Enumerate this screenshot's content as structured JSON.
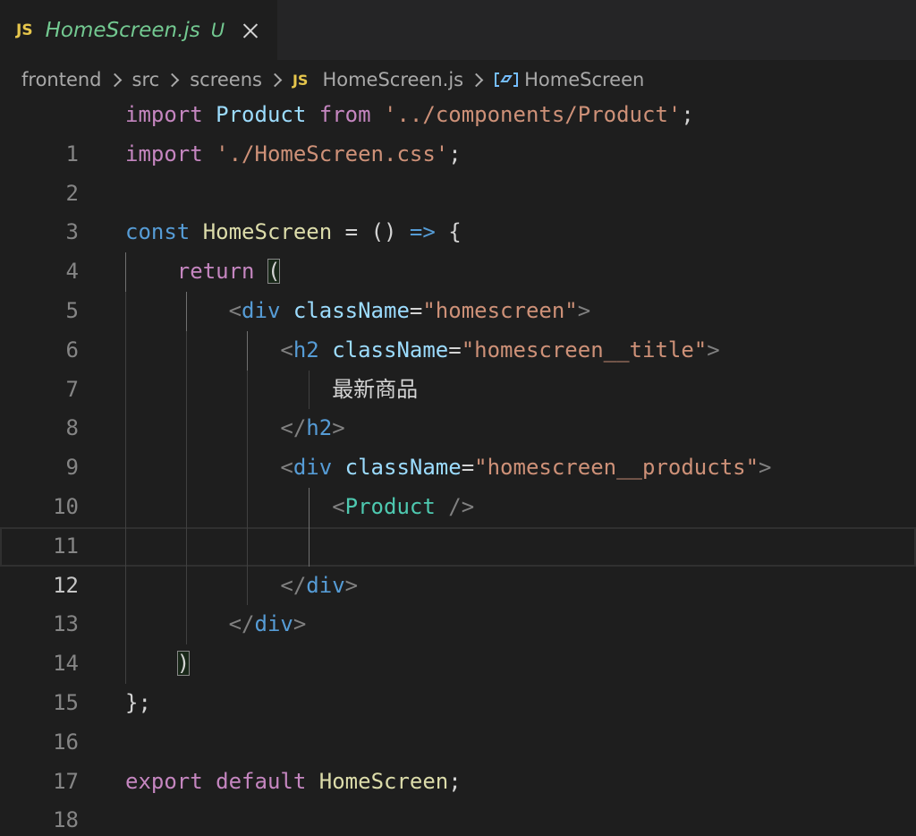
{
  "tab": {
    "badge": "JS",
    "filename": "HomeScreen.js",
    "status": "U"
  },
  "breadcrumbs": {
    "items": [
      "frontend",
      "src",
      "screens"
    ],
    "file_badge": "JS",
    "file": "HomeScreen.js",
    "symbol": "HomeScreen"
  },
  "colors": {
    "background": "#1e1e1e",
    "tab_text": "#73c991",
    "js_badge": "#e6c64c",
    "keyword_control": "#c586c0",
    "keyword": "#569cd6",
    "string": "#ce9178",
    "function": "#dcdcaa",
    "component": "#4ec9b0"
  },
  "editor": {
    "current_line": 12,
    "line_numbers": [
      "1",
      "2",
      "3",
      "4",
      "5",
      "6",
      "7",
      "8",
      "9",
      "10",
      "11",
      "12",
      "13",
      "14",
      "15",
      "16",
      "17",
      "18"
    ],
    "code": {
      "l1": {
        "import": "import",
        "name": "Product",
        "from": "from",
        "path": "'../components/Product'",
        "semi": ";"
      },
      "l2": {
        "import": "import",
        "path": "'./HomeScreen.css'",
        "semi": ";"
      },
      "l4": {
        "const": "const",
        "name": "HomeScreen",
        "eq": " = ",
        "parens": "()",
        "arrow": "=>",
        "brace": "{"
      },
      "l5": {
        "return": "return",
        "paren": "("
      },
      "l6": {
        "open": "<",
        "tag": "div",
        "attr": "className",
        "eq": "=",
        "value": "\"homescreen\"",
        "close": ">"
      },
      "l7": {
        "open": "<",
        "tag": "h2",
        "attr": "className",
        "eq": "=",
        "value": "\"homescreen__title\"",
        "close": ">"
      },
      "l8": {
        "text": "最新商品"
      },
      "l9": {
        "open": "</",
        "tag": "h2",
        "close": ">"
      },
      "l10": {
        "open": "<",
        "tag": "div",
        "attr": "className",
        "eq": "=",
        "value": "\"homescreen__products\"",
        "close": ">"
      },
      "l11": {
        "open": "<",
        "tag": "Product",
        "close": " />"
      },
      "l13": {
        "open": "</",
        "tag": "div",
        "close": ">"
      },
      "l14": {
        "open": "</",
        "tag": "div",
        "close": ">"
      },
      "l15": {
        "paren": ")"
      },
      "l16": {
        "end": "};"
      },
      "l18": {
        "export": "export",
        "default": "default",
        "name": "HomeScreen",
        "semi": ";"
      }
    }
  }
}
